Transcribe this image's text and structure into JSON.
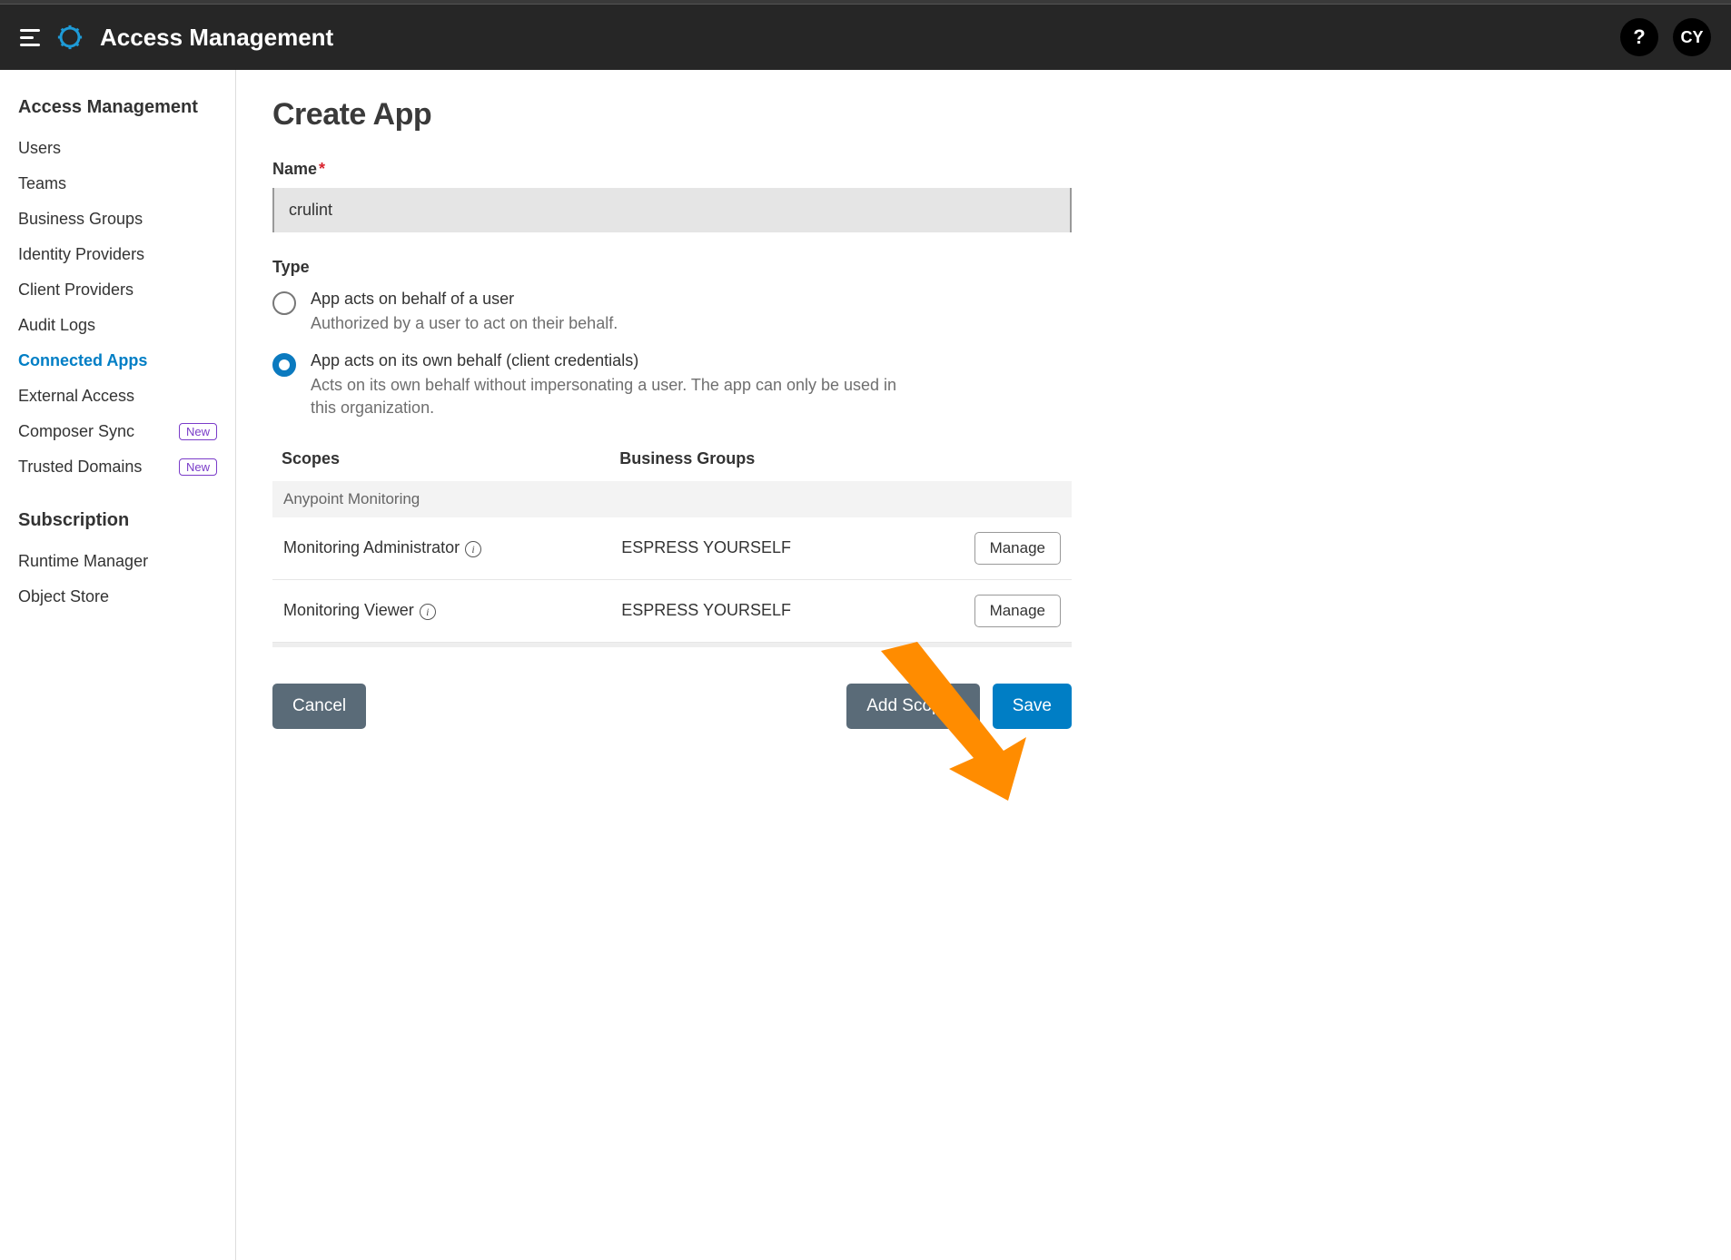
{
  "header": {
    "title": "Access Management",
    "help": "?",
    "avatar_initials": "CY"
  },
  "sidebar": {
    "section1_title": "Access Management",
    "items": [
      {
        "label": "Users",
        "active": false,
        "badge": null
      },
      {
        "label": "Teams",
        "active": false,
        "badge": null
      },
      {
        "label": "Business Groups",
        "active": false,
        "badge": null
      },
      {
        "label": "Identity Providers",
        "active": false,
        "badge": null
      },
      {
        "label": "Client Providers",
        "active": false,
        "badge": null
      },
      {
        "label": "Audit Logs",
        "active": false,
        "badge": null
      },
      {
        "label": "Connected Apps",
        "active": true,
        "badge": null
      },
      {
        "label": "External Access",
        "active": false,
        "badge": null
      },
      {
        "label": "Composer Sync",
        "active": false,
        "badge": "New"
      },
      {
        "label": "Trusted Domains",
        "active": false,
        "badge": "New"
      }
    ],
    "section2_title": "Subscription",
    "sub_items": [
      {
        "label": "Runtime Manager"
      },
      {
        "label": "Object Store"
      }
    ]
  },
  "main": {
    "page_title": "Create App",
    "name_label": "Name",
    "name_value": "crulint",
    "type_label": "Type",
    "type_options": [
      {
        "title": "App acts on behalf of a user",
        "desc": "Authorized by a user to act on their behalf.",
        "selected": false
      },
      {
        "title": "App acts on its own behalf (client credentials)",
        "desc": "Acts on its own behalf without impersonating a user. The app can only be used in this organization.",
        "selected": true
      }
    ],
    "table": {
      "col_scopes": "Scopes",
      "col_bgroups": "Business Groups",
      "group_header": "Anypoint Monitoring",
      "rows": [
        {
          "scope": "Monitoring Administrator",
          "group": "ESPRESS YOURSELF",
          "action": "Manage"
        },
        {
          "scope": "Monitoring Viewer",
          "group": "ESPRESS YOURSELF",
          "action": "Manage"
        }
      ]
    },
    "actions": {
      "cancel": "Cancel",
      "add_scopes": "Add Scopes",
      "save": "Save"
    }
  }
}
